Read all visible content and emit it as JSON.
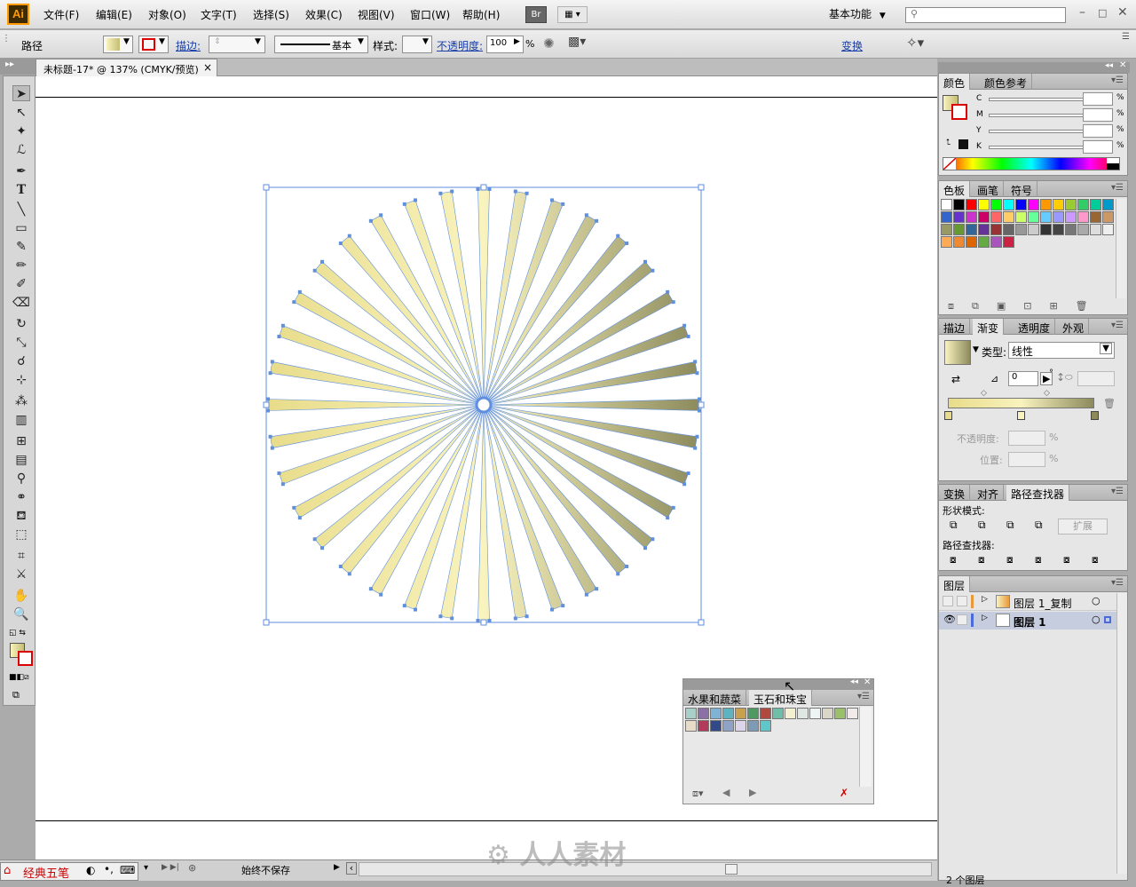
{
  "app": {
    "logo": "Ai",
    "workspace": "基本功能",
    "bridge": "Br"
  },
  "menu": [
    "文件(F)",
    "编辑(E)",
    "对象(O)",
    "文字(T)",
    "选择(S)",
    "效果(C)",
    "视图(V)",
    "窗口(W)",
    "帮助(H)"
  ],
  "control": {
    "object_label": "路径",
    "stroke_label": "描边:",
    "stroke_style": "基本",
    "style_label": "样式:",
    "opacity_label": "不透明度:",
    "opacity_value": "100",
    "percent": "%",
    "transform_label": "变换"
  },
  "document": {
    "tab_title": "未标题-17* @ 137% (CMYK/预览)",
    "close": "×"
  },
  "color_panel": {
    "tabs": [
      "颜色",
      "颜色参考"
    ],
    "channels": [
      "C",
      "M",
      "Y",
      "K"
    ],
    "percent": "%"
  },
  "swatch_panel": {
    "tabs": [
      "色板",
      "画笔",
      "符号"
    ]
  },
  "gradient_panel": {
    "tabs": [
      "描边",
      "渐变",
      "透明度",
      "外观"
    ],
    "type_label": "类型:",
    "type_value": "线性",
    "angle_value": "0",
    "degree": "°",
    "opacity_label": "不透明度:",
    "position_label": "位置:",
    "percent": "%",
    "colors": {
      "light": "#f9f3be",
      "mid": "#e8dc8a",
      "dark": "#8c8a5c"
    }
  },
  "pathfinder_panel": {
    "tabs": [
      "变换",
      "对齐",
      "路径查找器"
    ],
    "shape_modes_label": "形状模式:",
    "expand_label": "扩展",
    "pathfinders_label": "路径查找器:"
  },
  "layers_panel": {
    "tab": "图层",
    "layers": [
      {
        "name": "图层 1_复制",
        "visible": false,
        "selected": false
      },
      {
        "name": "图层 1",
        "visible": true,
        "selected": true
      }
    ],
    "footer": "2 个图层"
  },
  "floating_panel": {
    "tabs": [
      "水果和蔬菜",
      "玉石和珠宝"
    ]
  },
  "status": {
    "save_state": "始终不保存",
    "ime_label": "经典五笔"
  },
  "watermark": "人人素材",
  "artwork": {
    "ray_count": 36,
    "gradient_from": "#f9f3be",
    "gradient_to": "#8c8a5c",
    "selection_color": "#5f8fdd"
  }
}
